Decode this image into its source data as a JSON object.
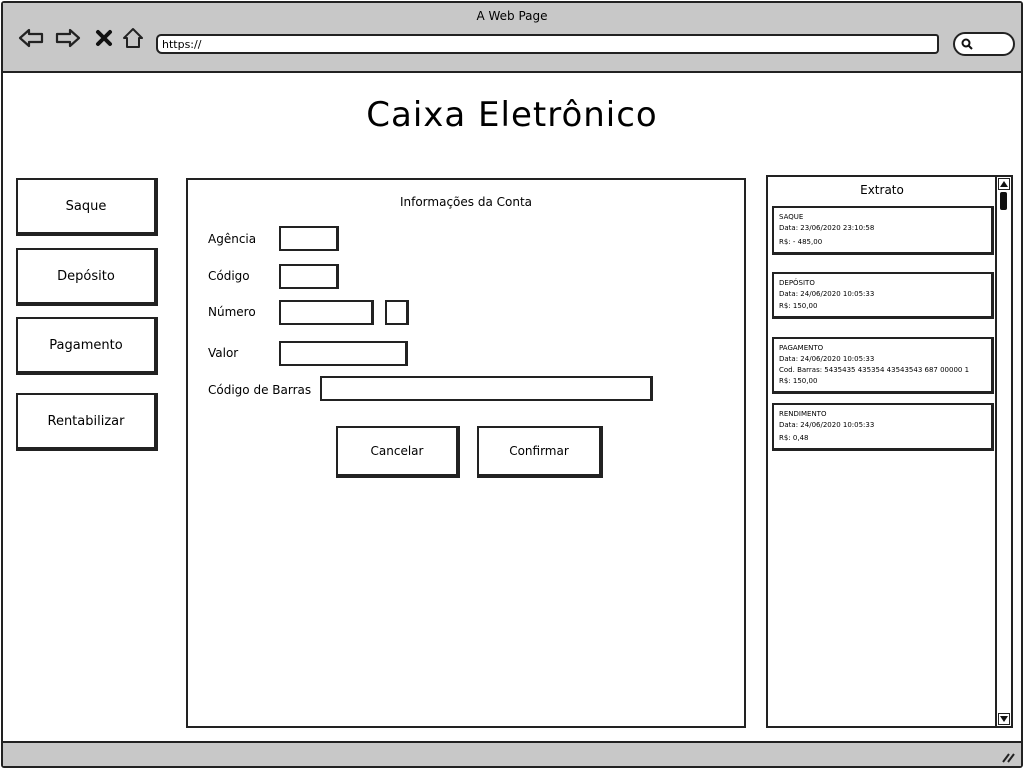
{
  "window": {
    "title": "A Web Page"
  },
  "browser": {
    "url": "https://",
    "icons": [
      "back-arrow-icon",
      "forward-arrow-icon",
      "close-icon",
      "home-icon",
      "search-icon"
    ]
  },
  "page": {
    "title": "Caixa Eletrônico"
  },
  "menu": [
    {
      "label": "Saque"
    },
    {
      "label": "Depósito"
    },
    {
      "label": "Pagamento"
    },
    {
      "label": "Rentabilizar"
    }
  ],
  "form": {
    "title": "Informações da Conta",
    "fields": {
      "agencia": {
        "label": "Agência",
        "value": ""
      },
      "codigo": {
        "label": "Código",
        "value": ""
      },
      "numero": {
        "label": "Número",
        "value": "",
        "digit": ""
      },
      "valor": {
        "label": "Valor",
        "value": ""
      },
      "codigo_barras": {
        "label": "Código de Barras",
        "value": ""
      }
    },
    "buttons": {
      "cancel": "Cancelar",
      "confirm": "Confirmar"
    }
  },
  "extrato": {
    "title": "Extrato",
    "items": [
      {
        "type": "SAQUE",
        "date": "Data: 23/06/2020 23:10:58",
        "value": "R$: - 485,00"
      },
      {
        "type": "DEPÓSITO",
        "date": "Data: 24/06/2020 10:05:33",
        "value": "R$: 150,00"
      },
      {
        "type": "PAGAMENTO",
        "date": "Data: 24/06/2020 10:05:33",
        "barcode": "Cod. Barras: 5435435 435354 43543543 687 00000 1",
        "value": "R$: 150,00"
      },
      {
        "type": "RENDIMENTO",
        "date": "Data: 24/06/2020 10:05:33",
        "value": "R$: 0,48"
      }
    ]
  }
}
